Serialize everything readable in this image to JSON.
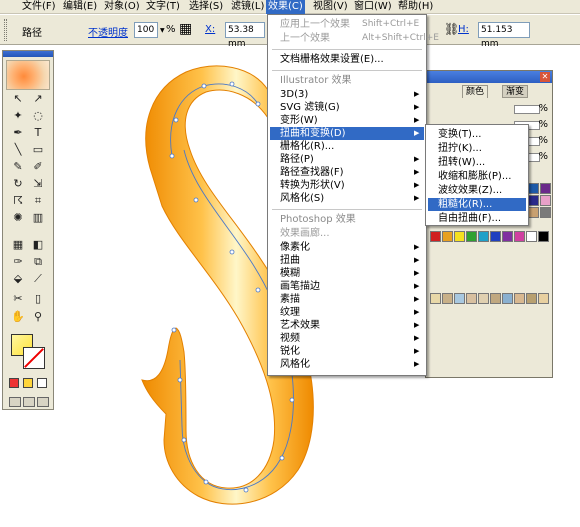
{
  "menubar": {
    "items": [
      {
        "label": "文件(F)"
      },
      {
        "label": "编辑(E)"
      },
      {
        "label": "对象(O)"
      },
      {
        "label": "文字(T)"
      },
      {
        "label": "选择(S)"
      },
      {
        "label": "滤镜(L)"
      },
      {
        "label": "效果(C)"
      },
      {
        "label": "视图(V)"
      },
      {
        "label": "窗口(W)"
      },
      {
        "label": "帮助(H)"
      }
    ]
  },
  "controlbar": {
    "path_label": "路径",
    "opacity_label": "不透明度",
    "opacity_value": "100",
    "percent": "%",
    "x_label": "X:",
    "x_value": "53.38 mm",
    "h_label": "H:",
    "h_value": "51.153 mm"
  },
  "effect_menu": {
    "apply_last": "应用上一个效果",
    "apply_last_shortcut": "Shift+Ctrl+E",
    "last_effect": "上一个效果",
    "last_effect_shortcut": "Alt+Shift+Ctrl+E",
    "raster_settings": "文档栅格效果设置(E)...",
    "illustrator_header": "Illustrator 效果",
    "items_ai": [
      {
        "label": "3D(3)"
      },
      {
        "label": "SVG 滤镜(G)"
      },
      {
        "label": "变形(W)"
      },
      {
        "label": "扭曲和变换(D)"
      },
      {
        "label": "栅格化(R)..."
      },
      {
        "label": "路径(P)"
      },
      {
        "label": "路径查找器(F)"
      },
      {
        "label": "转换为形状(V)"
      },
      {
        "label": "风格化(S)"
      }
    ],
    "photoshop_header": "Photoshop 效果",
    "effect_gallery": "效果画廊...",
    "items_ps": [
      {
        "label": "像素化"
      },
      {
        "label": "扭曲"
      },
      {
        "label": "模糊"
      },
      {
        "label": "画笔描边"
      },
      {
        "label": "素描"
      },
      {
        "label": "纹理"
      },
      {
        "label": "艺术效果"
      },
      {
        "label": "视频"
      },
      {
        "label": "锐化"
      },
      {
        "label": "风格化"
      }
    ]
  },
  "submenu": {
    "items": [
      {
        "label": "变换(T)..."
      },
      {
        "label": "扭拧(K)..."
      },
      {
        "label": "扭转(W)..."
      },
      {
        "label": "收缩和膨胀(P)..."
      },
      {
        "label": "波纹效果(Z)..."
      },
      {
        "label": "粗糙化(R)..."
      },
      {
        "label": "自由扭曲(F)..."
      }
    ]
  },
  "panel": {
    "tabs": [
      {
        "label": "颜色"
      },
      {
        "label": "渐变"
      }
    ],
    "percent": "%"
  },
  "colors": {
    "highlight": "#316ac5",
    "glyph_outer": "#f08c00",
    "glyph_inner": "#ffe34a"
  }
}
